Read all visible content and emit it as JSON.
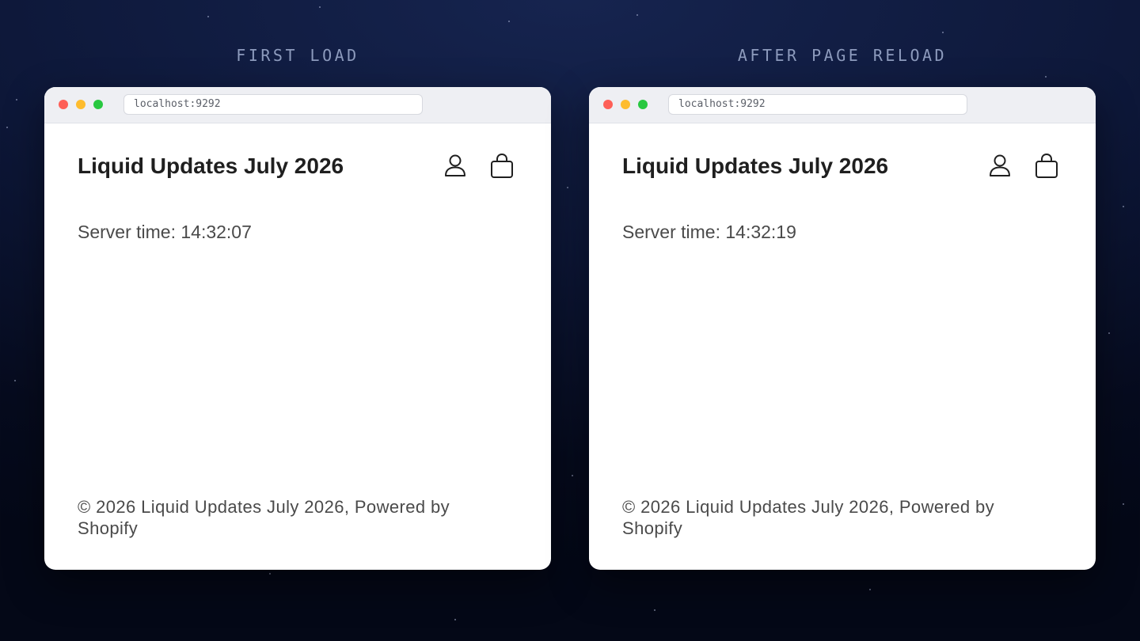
{
  "panels": [
    {
      "label": "FIRST LOAD",
      "url": "localhost:9292",
      "site_title": "Liquid Updates July 2026",
      "server_time": "Server time: 14:32:07",
      "footer": "© 2026 Liquid Updates July 2026, Powered by Shopify"
    },
    {
      "label": "AFTER PAGE RELOAD",
      "url": "localhost:9292",
      "site_title": "Liquid Updates July 2026",
      "server_time": "Server time: 14:32:19",
      "footer": "© 2026 Liquid Updates July 2026, Powered by Shopify"
    }
  ],
  "icons": {
    "account": "account-icon",
    "cart": "cart-bag-icon"
  },
  "colors": {
    "traffic_red": "#fe5f57",
    "traffic_yellow": "#febc2e",
    "traffic_green": "#28c840",
    "label": "#8d9bbd",
    "title": "#1f1f1f",
    "body_text": "#4a4a4a"
  }
}
